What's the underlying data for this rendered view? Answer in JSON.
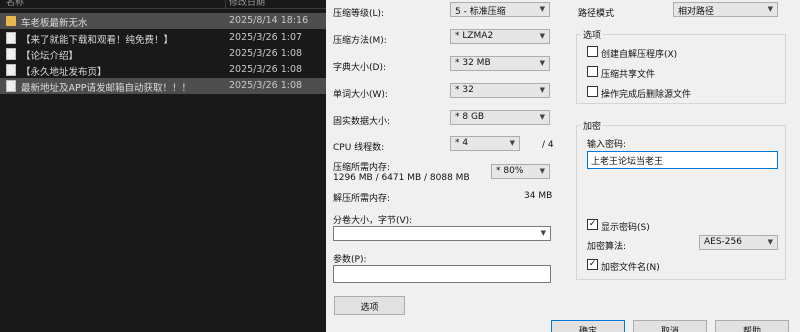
{
  "file_list": {
    "columns": [
      "名称",
      "修改日期"
    ],
    "rows": [
      {
        "icon": "folder-icon",
        "name": "车老板最新无水",
        "date": "2025/8/14 18:16",
        "selected": true
      },
      {
        "icon": "document-icon",
        "name": "【来了就能下载和观看！纯免费！】",
        "date": "2025/3/26 1:07",
        "selected": false
      },
      {
        "icon": "document-icon",
        "name": "【论坛介绍】",
        "date": "2025/3/26 1:08",
        "selected": false
      },
      {
        "icon": "document-icon",
        "name": "【永久地址发布页】",
        "date": "2025/3/26 1:08",
        "selected": false
      },
      {
        "icon": "document-icon",
        "name": "最新地址及APP请发邮箱自动获取！！！",
        "date": "2025/3/26 1:08",
        "selected": true
      }
    ]
  },
  "compression": {
    "level_label": "压缩等级(L):",
    "level_value": "5 - 标准压缩",
    "method_label": "压缩方法(M):",
    "method_value": "* LZMA2",
    "dict_label": "字典大小(D):",
    "dict_value": "* 32 MB",
    "word_label": "单词大小(W):",
    "word_value": "* 32",
    "solid_label": "固实数据大小:",
    "solid_value": "* 8 GB",
    "threads_label": "CPU 线程数:",
    "threads_value": "* 4",
    "threads_max": "/ 4",
    "mem_comp_label": "压缩所需内存:",
    "mem_comp_value": "1296 MB / 6471 MB / 8088 MB",
    "mem_percent": "* 80%",
    "mem_decomp_label": "解压所需内存:",
    "mem_decomp_value": "34 MB",
    "volume_label": "分卷大小，字节(V):",
    "volume_value": "",
    "params_label": "参数(P):",
    "params_value": "",
    "options_button": "选项"
  },
  "path_mode": {
    "label": "路径模式",
    "value": "相对路径"
  },
  "options": {
    "title": "选项",
    "items": [
      {
        "label": "创建自解压程序(X)",
        "checked": false
      },
      {
        "label": "压缩共享文件",
        "checked": false
      },
      {
        "label": "操作完成后删除源文件",
        "checked": false
      }
    ]
  },
  "encryption": {
    "title": "加密",
    "password_label": "输入密码:",
    "password_value": "上老王论坛当老王",
    "show_password_label": "显示密码(S)",
    "show_password_checked": true,
    "method_label": "加密算法:",
    "method_value": "AES-256",
    "encrypt_names_label": "加密文件名(N)",
    "encrypt_names_checked": true
  },
  "buttons": {
    "ok": "确定",
    "cancel": "取消",
    "help": "帮助"
  },
  "colors": {
    "list_background": "#191919",
    "selected_row": "#4d4d4d",
    "dialog_background": "#f0f0f0",
    "focus_blue": "#0078d7"
  }
}
